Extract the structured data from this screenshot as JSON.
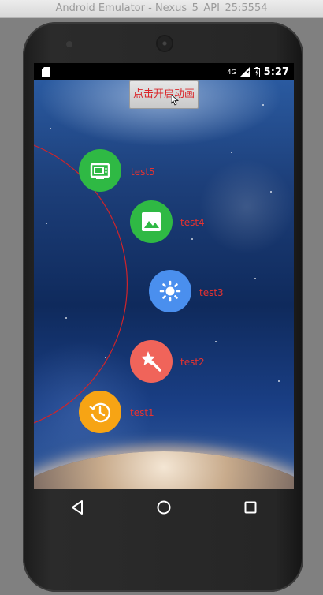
{
  "window": {
    "title": "Android Emulator - Nexus_5_API_25:5554"
  },
  "statusbar": {
    "network": "4G",
    "time": "5:27"
  },
  "app": {
    "start_button_label": "点击开启动画"
  },
  "menu": {
    "items": [
      {
        "label": "test5",
        "icon": "tv-icon",
        "color": "#2fb944"
      },
      {
        "label": "test4",
        "icon": "image-icon",
        "color": "#2fb944"
      },
      {
        "label": "test3",
        "icon": "brightness-icon",
        "color": "#4a8fee"
      },
      {
        "label": "test2",
        "icon": "magic-wand-icon",
        "color": "#f0645a"
      },
      {
        "label": "test1",
        "icon": "history-icon",
        "color": "#f7a414"
      }
    ],
    "label_color": "#e8322f",
    "arc_color": "#d0242a"
  },
  "navbar": {
    "back": "back-icon",
    "home": "home-icon",
    "recents": "recents-icon"
  }
}
